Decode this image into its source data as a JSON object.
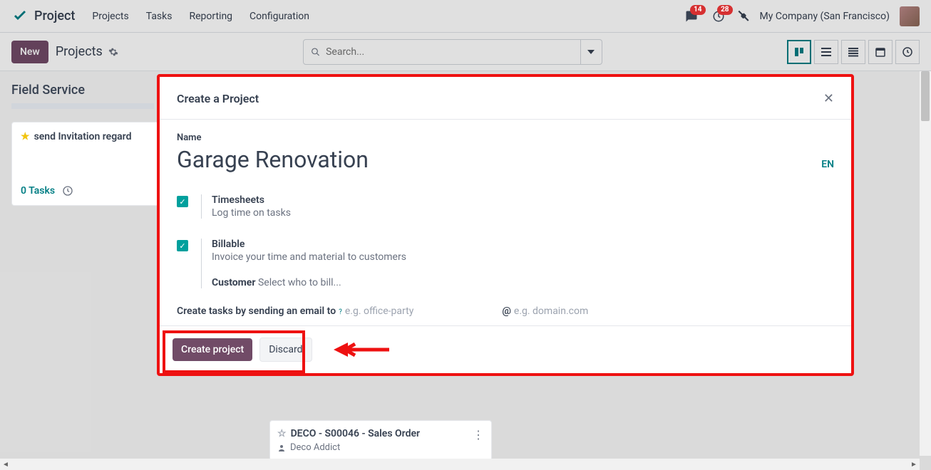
{
  "app": {
    "title": "Project"
  },
  "nav": {
    "projects": "Projects",
    "tasks": "Tasks",
    "reporting": "Reporting",
    "configuration": "Configuration"
  },
  "topright": {
    "badge1": "14",
    "badge2": "28",
    "company": "My Company (San Francisco)"
  },
  "control": {
    "new": "New",
    "breadcrumb": "Projects",
    "search_placeholder": "Search..."
  },
  "section": {
    "title": "Field Service",
    "card_title": "send Invitation regard",
    "tasks_count": "0 Tasks"
  },
  "modal": {
    "title": "Create a Project",
    "name_label": "Name",
    "name_value": "Garage Renovation",
    "lang": "EN",
    "timesheets": {
      "title": "Timesheets",
      "desc": "Log time on tasks"
    },
    "billable": {
      "title": "Billable",
      "desc": "Invoice your time and material to customers"
    },
    "customer_label": "Customer",
    "customer_placeholder": "Select who to bill...",
    "email_prefix": "Create tasks by sending an email to",
    "email_ph1": "e.g. office-party",
    "email_at": "@",
    "email_ph2": "e.g. domain.com",
    "create": "Create project",
    "discard": "Discard"
  },
  "peek": {
    "title": "DECO - S00046 - Sales Order",
    "sub": "Deco Addict"
  }
}
